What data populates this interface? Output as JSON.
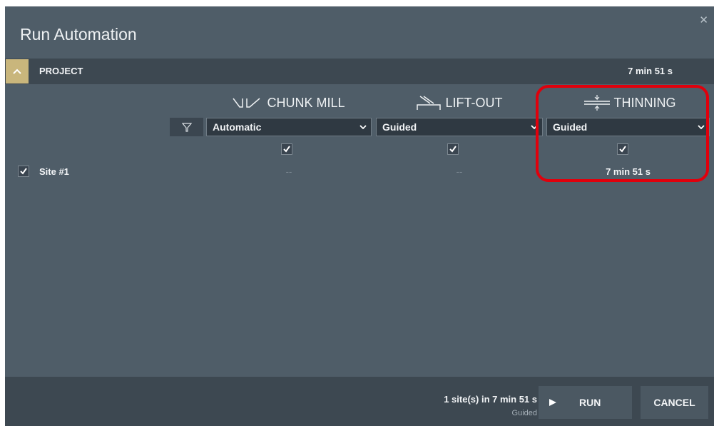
{
  "dialog": {
    "title": "Run Automation"
  },
  "project": {
    "label": "PROJECT",
    "total_time": "7 min 51 s"
  },
  "columns": [
    {
      "name": "CHUNK MILL",
      "icon": "chunk-mill-icon",
      "mode": "Automatic"
    },
    {
      "name": "LIFT-OUT",
      "icon": "lift-out-icon",
      "mode": "Guided"
    },
    {
      "name": "THINNING",
      "icon": "thinning-icon",
      "mode": "Guided"
    }
  ],
  "sites": [
    {
      "label": "Site #1",
      "checked": true,
      "cells": [
        "--",
        "--",
        "7 min 51 s"
      ]
    }
  ],
  "footer": {
    "summary": "1 site(s) in 7 min 51 s",
    "summary_sub": "Guided",
    "run_label": "RUN",
    "cancel_label": "CANCEL"
  },
  "colors": {
    "accent": "#c9b67c",
    "highlight": "#e0000c",
    "panel": "#4f5d68",
    "bar": "#3d4851"
  }
}
